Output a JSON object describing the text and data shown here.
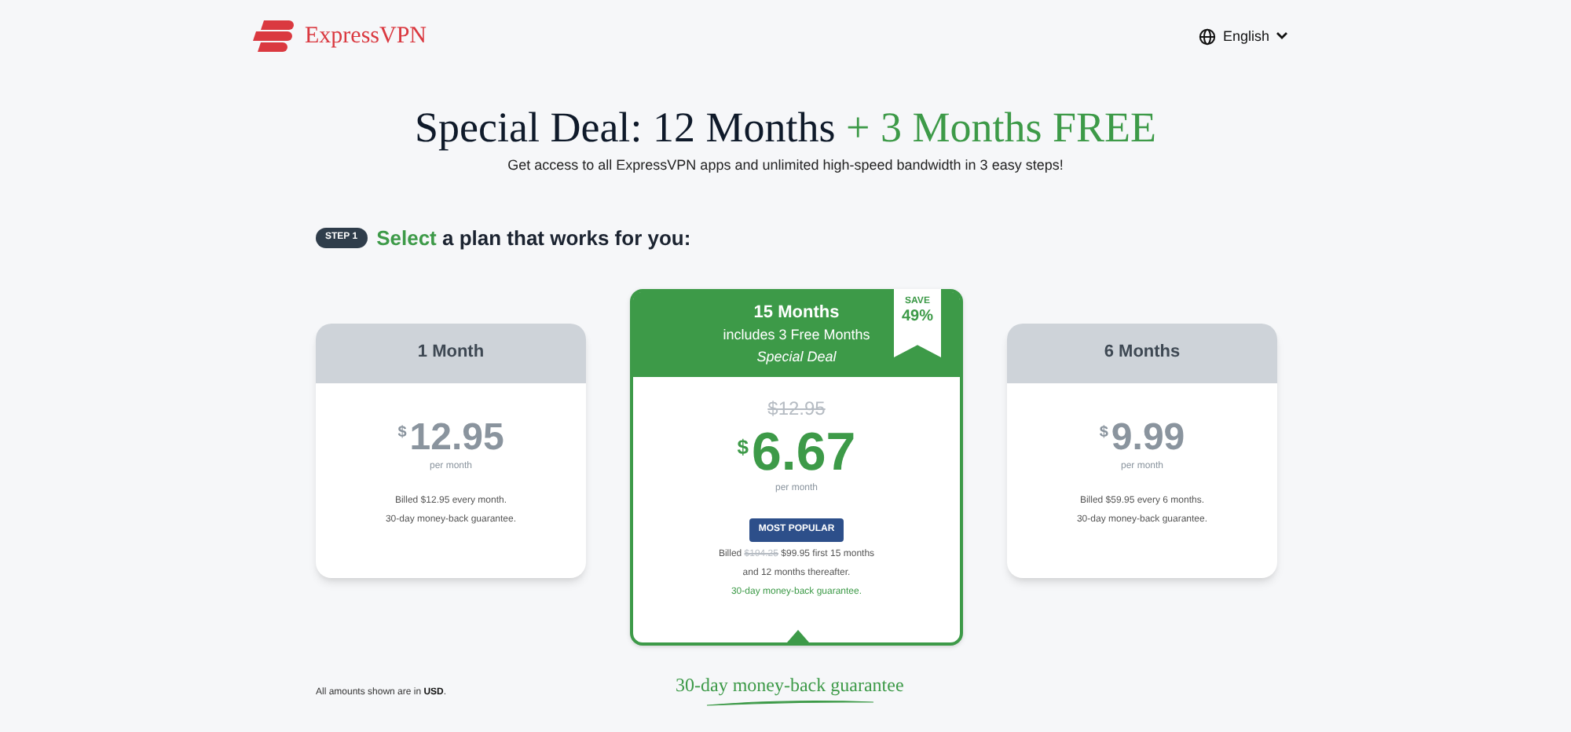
{
  "header": {
    "brand": "ExpressVPN",
    "language": "English"
  },
  "headline": {
    "main": "Special Deal: 12 Months",
    "accent": "+ 3 Months FREE"
  },
  "subtitle": "Get access to all ExpressVPN apps and unlimited high-speed bandwidth in 3 easy steps!",
  "step": {
    "badge": "STEP 1",
    "accent": "Select",
    "rest": "a plan that works for you:"
  },
  "plans": [
    {
      "title": "1 Month",
      "selected": false,
      "currency": "$",
      "price": "12.95",
      "period": "per month",
      "notes": [
        "Billed $12.95 every month.",
        "30-day money-back guarantee."
      ]
    },
    {
      "title": "15 Months",
      "selected": true,
      "subtitle": "includes 3 Free Months",
      "deal": "Special Deal",
      "save_label": "SAVE",
      "save_value": "49%",
      "old_price": "$12.95",
      "currency": "$",
      "price": "6.67",
      "period": "per month",
      "badge": "MOST POPULAR",
      "billed": {
        "prefix": "Billed",
        "old": "$194.25",
        "rest": "$99.95 first 15 months"
      },
      "notes": [
        "and 12 months thereafter.",
        "30-day money-back guarantee."
      ]
    },
    {
      "title": "6 Months",
      "selected": false,
      "currency": "$",
      "price": "9.99",
      "period": "per month",
      "notes": [
        "Billed $59.95 every 6 months.",
        "30-day money-back guarantee."
      ]
    }
  ],
  "footer": {
    "currency_note_prefix": "All amounts shown are in",
    "currency_code": "USD",
    "currency_note_suffix": ".",
    "guarantee": "30-day money-back guarantee"
  }
}
